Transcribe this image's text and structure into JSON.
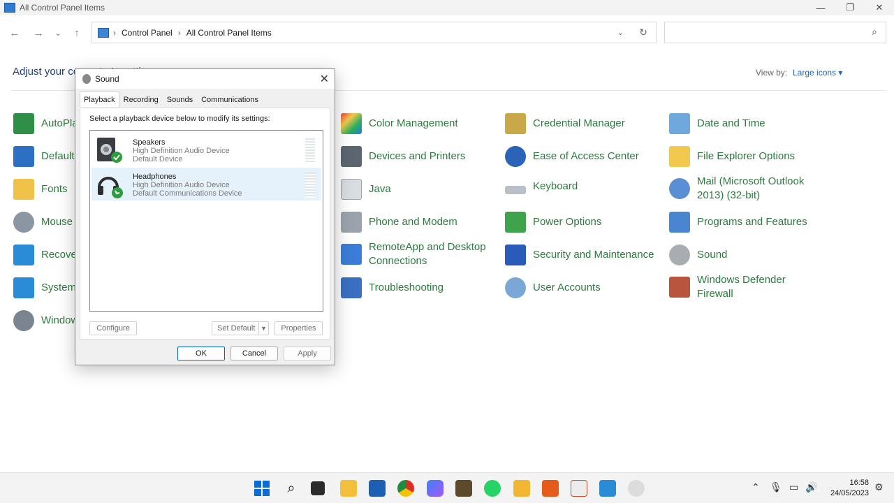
{
  "window": {
    "title": "All Control Panel Items",
    "minimize": "—",
    "maximize": "❐",
    "close": "✕"
  },
  "nav": {
    "back": "←",
    "forward": "→",
    "recent": "⌄",
    "up": "↑"
  },
  "address": {
    "crumb1": "Control Panel",
    "crumb2": "All Control Panel Items",
    "separator": "›"
  },
  "search": {
    "placeholder": ""
  },
  "header": {
    "adjust_text": "Adjust your computer's settings",
    "view_by_label": "View by:",
    "view_by_value": "Large icons ▾"
  },
  "items_col0": [
    "AutoPlay",
    "Default Programs",
    "Fonts",
    "Mouse",
    "Recovery",
    "System",
    "Windows Tools"
  ],
  "items_col2": [
    "Color Management",
    "Devices and Printers",
    "Java",
    "Phone and Modem",
    "RemoteApp and Desktop Connections",
    "Troubleshooting"
  ],
  "items_col3": [
    "Credential Manager",
    "Ease of Access Center",
    "Keyboard",
    "Power Options",
    "Security and Maintenance",
    "User Accounts"
  ],
  "items_col4": [
    "Date and Time",
    "File Explorer Options",
    "Mail (Microsoft Outlook 2013) (32-bit)",
    "Programs and Features",
    "Sound",
    "Windows Defender Firewall"
  ],
  "dialog": {
    "title": "Sound",
    "close": "✕",
    "tabs": [
      "Playback",
      "Recording",
      "Sounds",
      "Communications"
    ],
    "instruction": "Select a playback device below to modify its settings:",
    "devices": [
      {
        "name": "Speakers",
        "line1": "High Definition Audio Device",
        "line2": "Default Device"
      },
      {
        "name": "Headphones",
        "line1": "High Definition Audio Device",
        "line2": "Default Communications Device"
      }
    ],
    "buttons": {
      "configure": "Configure",
      "set_default": "Set Default",
      "properties": "Properties",
      "ok": "OK",
      "cancel": "Cancel",
      "apply": "Apply"
    }
  },
  "taskbar": {
    "time": "16:58",
    "date": "24/05/2023"
  },
  "colors": {
    "link_green": "#2d7a3e",
    "accent_blue": "#0067c0",
    "header_blue": "#1e3f78"
  }
}
